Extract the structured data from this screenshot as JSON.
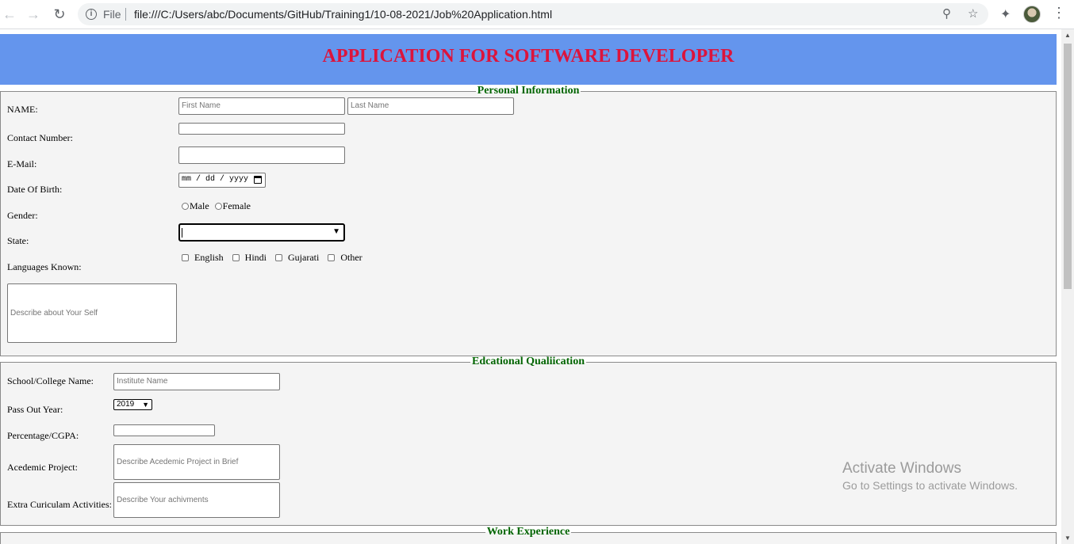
{
  "browser": {
    "scheme": "File",
    "url": "file:///C:/Users/abc/Documents/GitHub/Training1/10-08-2021/Job%20Application.html"
  },
  "page": {
    "title": "APPLICATION FOR SOFTWARE DEVELOPER",
    "personal": {
      "legend": "Personal Information",
      "name_label": "NAME:",
      "first_name_placeholder": "First Name",
      "last_name_placeholder": "Last Name",
      "contact_label": "Contact Number:",
      "email_label": "E-Mail:",
      "dob_label": "Date Of Birth:",
      "dob_placeholder": "mm / dd / yyyy",
      "gender_label": "Gender:",
      "gender_options": [
        "Male",
        "Female"
      ],
      "state_label": "State:",
      "state_value": "",
      "languages_label": "Languages Known:",
      "languages": [
        "English",
        "Hindi",
        "Gujarati",
        "Other"
      ],
      "about_placeholder": "Describe about Your Self"
    },
    "education": {
      "legend": "Edcational Qualiication",
      "school_label": "School/College Name:",
      "school_placeholder": "Institute Name",
      "passout_label": "Pass Out Year:",
      "passout_value": "2019",
      "percentage_label": "Percentage/CGPA:",
      "project_label": "Acedemic Project:",
      "project_placeholder": "Describe Acedemic Project in Brief",
      "extra_label": "Extra Curiculam Activities:",
      "extra_placeholder": "Describe Your achivments"
    },
    "work": {
      "legend": "Work Experience"
    }
  },
  "watermark": {
    "title": "Activate Windows",
    "subtitle": "Go to Settings to activate Windows."
  }
}
